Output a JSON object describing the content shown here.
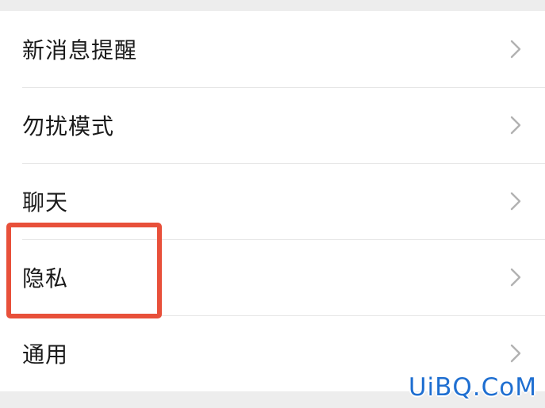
{
  "settings": {
    "items": [
      {
        "label": "新消息提醒",
        "icon": "chevron-right-icon"
      },
      {
        "label": "勿扰模式",
        "icon": "chevron-right-icon"
      },
      {
        "label": "聊天",
        "icon": "chevron-right-icon"
      },
      {
        "label": "隐私",
        "icon": "chevron-right-icon"
      },
      {
        "label": "通用",
        "icon": "chevron-right-icon"
      }
    ]
  },
  "annotation": {
    "highlighted_item": "隐私",
    "color": "#e8503a"
  },
  "watermark": {
    "text": "UiBQ.CoM",
    "color": "#1f6fd1"
  },
  "colors": {
    "background": "#ededed",
    "list_background": "#ffffff",
    "text": "#1a1a1a",
    "chevron": "#b2b2b2",
    "divider": "#e6e6e6"
  }
}
